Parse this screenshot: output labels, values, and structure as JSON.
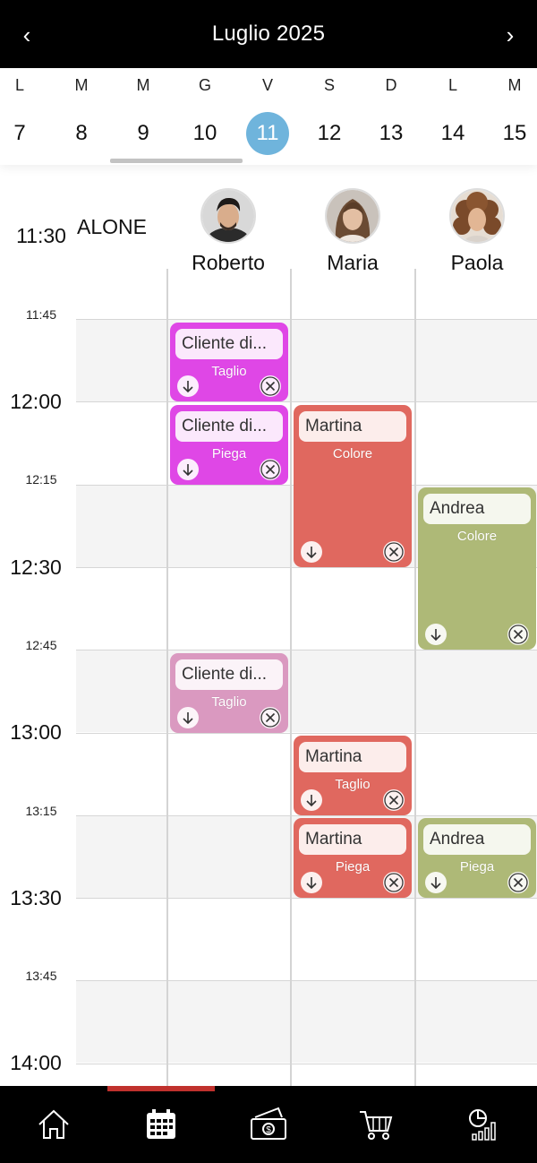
{
  "header": {
    "title": "Luglio 2025",
    "prev": "‹",
    "next": "›"
  },
  "week": {
    "letters": [
      "L",
      "M",
      "M",
      "G",
      "V",
      "S",
      "D",
      "L",
      "M"
    ],
    "numbers": [
      "7",
      "8",
      "9",
      "10",
      "11",
      "12",
      "13",
      "14",
      "15"
    ],
    "selected_index": 4
  },
  "schedule": {
    "top_label": "ALONE",
    "top_time": "11:30",
    "times": [
      "11:45",
      "12:00",
      "12:15",
      "12:30",
      "12:45",
      "13:00",
      "13:15",
      "13:30",
      "13:45",
      "14:00"
    ],
    "staff": [
      {
        "name": "Roberto",
        "avatar": "avatar-roberto"
      },
      {
        "name": "Maria",
        "avatar": "avatar-maria"
      },
      {
        "name": "Paola",
        "avatar": "avatar-paola"
      }
    ],
    "appointments": [
      {
        "client": "Cliente di...",
        "service": "Taglio",
        "color": "#df47e6"
      },
      {
        "client": "Cliente di...",
        "service": "Piega",
        "color": "#df47e6"
      },
      {
        "client": "Cliente di...",
        "service": "Taglio",
        "color": "#da99c0"
      },
      {
        "client": "Martina",
        "service": "Colore",
        "color": "#e0685f"
      },
      {
        "client": "Martina",
        "service": "Taglio",
        "color": "#e0685f"
      },
      {
        "client": "Martina",
        "service": "Piega",
        "color": "#e0685f"
      },
      {
        "client": "Andrea",
        "service": "Colore",
        "color": "#aeb977"
      },
      {
        "client": "Andrea",
        "service": "Piega",
        "color": "#aeb977"
      }
    ]
  },
  "bottom_nav": {
    "items": [
      "home-icon",
      "calendar-icon",
      "money-icon",
      "cart-icon",
      "stats-icon"
    ],
    "active_index": 1,
    "active_color": "#c0312d"
  },
  "colors": {
    "selected_day": "#6fb4dc",
    "header_bg": "#000000"
  }
}
